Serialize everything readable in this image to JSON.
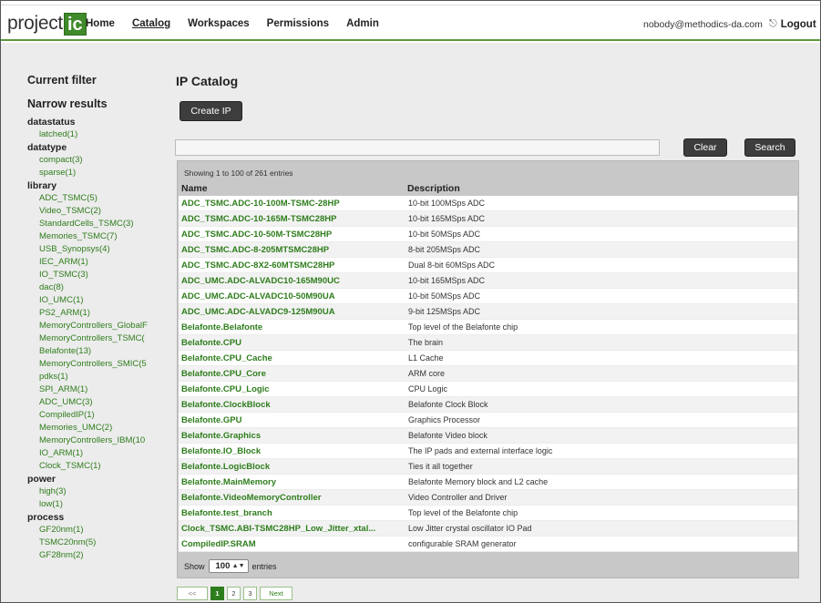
{
  "app": {
    "logo_text": "project",
    "logo_box": "ic"
  },
  "nav": {
    "items": [
      "Home",
      "Catalog",
      "Workspaces",
      "Permissions",
      "Admin"
    ],
    "active": "Catalog",
    "user_email": "nobody@methodics-da.com",
    "logout_label": "Logout"
  },
  "sidebar": {
    "current_filter": "Current filter",
    "narrow_results": "Narrow results",
    "groups": [
      {
        "label": "datastatus",
        "items": [
          "latched(1)"
        ]
      },
      {
        "label": "datatype",
        "items": [
          "compact(3)",
          "sparse(1)"
        ]
      },
      {
        "label": "library",
        "items": [
          "ADC_TSMC(5)",
          "Video_TSMC(2)",
          "StandardCells_TSMC(3)",
          "Memories_TSMC(7)",
          "USB_Synopsys(4)",
          "IEC_ARM(1)",
          "IO_TSMC(3)",
          "dac(8)",
          "IO_UMC(1)",
          "PS2_ARM(1)",
          "MemoryControllers_GlobalF",
          "MemoryControllers_TSMC(",
          "Belafonte(13)",
          "MemoryControllers_SMIC(5",
          "pdks(1)",
          "SPI_ARM(1)",
          "ADC_UMC(3)",
          "CompiledIP(1)",
          "Memories_UMC(2)",
          "MemoryControllers_IBM(10",
          "IO_ARM(1)",
          "Clock_TSMC(1)"
        ]
      },
      {
        "label": "power",
        "items": [
          "high(3)",
          "low(1)"
        ]
      },
      {
        "label": "process",
        "items": [
          "GF20nm(1)",
          "TSMC20nm(5)",
          "GF28nm(2)"
        ]
      }
    ]
  },
  "main": {
    "title": "IP Catalog",
    "create_button": "Create IP",
    "search_value": "",
    "clear_button": "Clear",
    "search_button": "Search",
    "showing": "Showing 1 to 100 of 261 entries",
    "columns": [
      "Name",
      "Description"
    ],
    "rows": [
      [
        "ADC_TSMC.ADC-10-100M-TSMC-28HP",
        "10-bit 100MSps ADC"
      ],
      [
        "ADC_TSMC.ADC-10-165M-TSMC28HP",
        "10-bit 165MSps ADC"
      ],
      [
        "ADC_TSMC.ADC-10-50M-TSMC28HP",
        "10-bit 50MSps ADC"
      ],
      [
        "ADC_TSMC.ADC-8-205MTSMC28HP",
        "8-bit 205MSps ADC"
      ],
      [
        "ADC_TSMC.ADC-8X2-60MTSMC28HP",
        "Dual 8-bit 60MSps ADC"
      ],
      [
        "ADC_UMC.ADC-ALVADC10-165M90UC",
        "10-bit 165MSps ADC"
      ],
      [
        "ADC_UMC.ADC-ALVADC10-50M90UA",
        "10-bit 50MSps ADC"
      ],
      [
        "ADC_UMC.ADC-ALVADC9-125M90UA",
        "9-bit 125MSps ADC"
      ],
      [
        "Belafonte.Belafonte",
        "Top level of the Belafonte chip"
      ],
      [
        "Belafonte.CPU",
        "The brain"
      ],
      [
        "Belafonte.CPU_Cache",
        "L1 Cache"
      ],
      [
        "Belafonte.CPU_Core",
        "ARM core"
      ],
      [
        "Belafonte.CPU_Logic",
        "CPU Logic"
      ],
      [
        "Belafonte.ClockBlock",
        "Belafonte Clock Block"
      ],
      [
        "Belafonte.GPU",
        "Graphics Processor"
      ],
      [
        "Belafonte.Graphics",
        "Belafonte Video block"
      ],
      [
        "Belafonte.IO_Block",
        "The IP pads and external interface logic"
      ],
      [
        "Belafonte.LogicBlock",
        "Ties it all together"
      ],
      [
        "Belafonte.MainMemory",
        "Belafonte Memory block and L2 cache"
      ],
      [
        "Belafonte.VideoMemoryController",
        "Video Controller and Driver"
      ],
      [
        "Belafonte.test_branch",
        "Top level of the Belafonte chip"
      ],
      [
        "Clock_TSMC.ABI-TSMC28HP_Low_Jitter_xtal...",
        "Low Jitter crystal oscillator IO Pad"
      ],
      [
        "CompiledIP.SRAM",
        "configurable SRAM generator"
      ]
    ],
    "show_label": "Show",
    "show_value": "100",
    "entries_label": "entries"
  },
  "pager": {
    "prev": "<< Prev",
    "pages": [
      "1",
      "2",
      "3"
    ],
    "current": "1",
    "next": "Next >>"
  }
}
